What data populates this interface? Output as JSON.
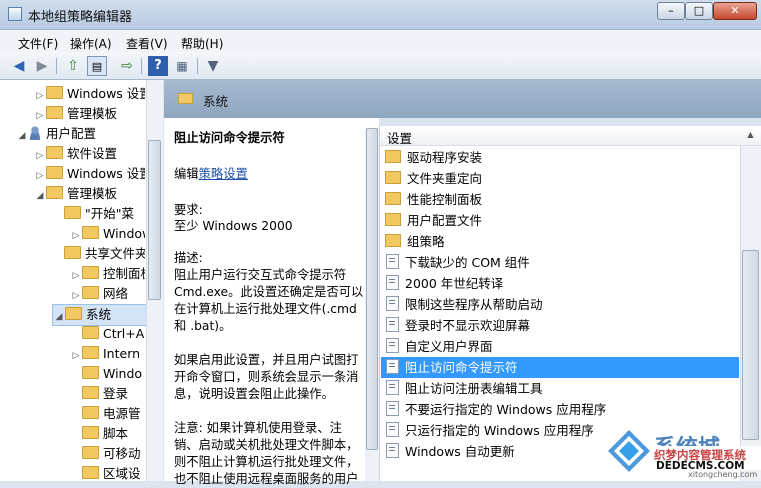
{
  "window": {
    "title": "本地组策略编辑器",
    "min": "–",
    "max": "□",
    "close": "✕"
  },
  "menu": [
    "文件(F)",
    "操作(A)",
    "查看(V)",
    "帮助(H)"
  ],
  "toolbar_icons": [
    "back-arrow-icon",
    "forward-arrow-icon",
    "up-folder-icon",
    "show-tree-icon",
    "export-icon",
    "help-icon",
    "properties-icon",
    "filter-icon"
  ],
  "tree": [
    {
      "label": "Windows 设置",
      "type": "folder",
      "expander": "▷"
    },
    {
      "label": "管理模板",
      "type": "folder",
      "expander": "▷"
    },
    {
      "label": "用户配置",
      "type": "user",
      "expander": "◢"
    },
    {
      "label": "软件设置",
      "type": "folder",
      "expander": "▷"
    },
    {
      "label": "Windows 设置",
      "type": "folder",
      "expander": "▷"
    },
    {
      "label": "管理模板",
      "type": "folder",
      "expander": "◢"
    },
    {
      "label": "\"开始\"菜",
      "type": "folder",
      "expander": ""
    },
    {
      "label": "Windows",
      "type": "folder",
      "expander": "▷"
    },
    {
      "label": "共享文件夹",
      "type": "folder",
      "expander": ""
    },
    {
      "label": "控制面板",
      "type": "folder",
      "expander": "▷"
    },
    {
      "label": "网络",
      "type": "folder",
      "expander": "▷"
    },
    {
      "label": "系统",
      "type": "folder",
      "expander": "◢",
      "selected": true
    },
    {
      "label": "Ctrl+A",
      "type": "folder",
      "expander": ""
    },
    {
      "label": "Intern",
      "type": "folder",
      "expander": "▷"
    },
    {
      "label": "Windo",
      "type": "folder",
      "expander": ""
    },
    {
      "label": "登录",
      "type": "folder",
      "expander": ""
    },
    {
      "label": "电源管",
      "type": "folder",
      "expander": ""
    },
    {
      "label": "脚本",
      "type": "folder",
      "expander": ""
    },
    {
      "label": "可移动",
      "type": "folder",
      "expander": ""
    },
    {
      "label": "区域设",
      "type": "folder",
      "expander": ""
    }
  ],
  "breadcrumb": "系统",
  "description": {
    "title": "阻止访问命令提示符",
    "edit_prefix": "编辑",
    "edit_link": "策略设置",
    "req_label": "要求:",
    "req_value": "至少 Windows 2000",
    "desc_label": "描述:",
    "desc_lines": [
      "阻止用户运行交互式命令提示符",
      "Cmd.exe。此设置还确定是否可以",
      "在计算机上运行批处理文件(.cmd",
      "和 .bat)。"
    ],
    "enabled_lines": [
      "如果启用此设置，并且用户试图打",
      "开命令窗口，则系统会显示一条消",
      "息，说明设置会阻止此操作。"
    ],
    "note_lines": [
      "注意: 如果计算机使用登录、注",
      "销、启动或关机批处理文件脚本，",
      "则不阻止计算机运行批处理文件，",
      "也不阻止使用远程桌面服务的用户"
    ]
  },
  "list": {
    "header": "设置",
    "rows": [
      {
        "label": "驱动程序安装",
        "type": "folder"
      },
      {
        "label": "文件夹重定向",
        "type": "folder"
      },
      {
        "label": "性能控制面板",
        "type": "folder"
      },
      {
        "label": "用户配置文件",
        "type": "folder"
      },
      {
        "label": "组策略",
        "type": "folder"
      },
      {
        "label": "下载缺少的 COM 组件",
        "type": "policy"
      },
      {
        "label": "2000 年世纪转译",
        "type": "policy"
      },
      {
        "label": "限制这些程序从帮助启动",
        "type": "policy"
      },
      {
        "label": "登录时不显示欢迎屏幕",
        "type": "policy"
      },
      {
        "label": "自定义用户界面",
        "type": "policy"
      },
      {
        "label": "阻止访问命令提示符",
        "type": "policy",
        "selected": true
      },
      {
        "label": "阻止访问注册表编辑工具",
        "type": "policy"
      },
      {
        "label": "不要运行指定的 Windows 应用程序",
        "type": "policy"
      },
      {
        "label": "只运行指定的 Windows 应用程序",
        "type": "policy"
      },
      {
        "label": "Windows 自动更新",
        "type": "policy"
      }
    ]
  },
  "watermark": {
    "brand": "系统城",
    "line1": "织梦内容管理系统",
    "line2": "DEDECMS.COM",
    "url": "xitongcheng.com"
  }
}
